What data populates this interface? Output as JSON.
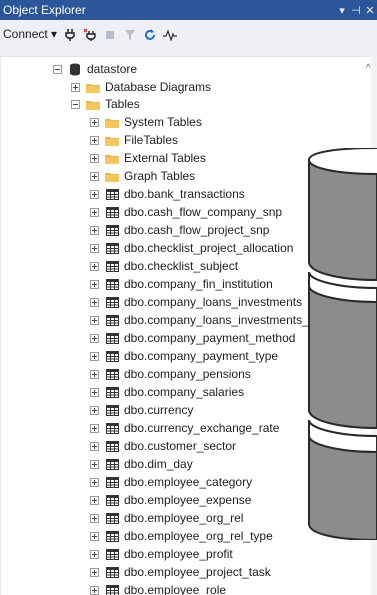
{
  "panel": {
    "title": "Object Explorer",
    "controls": [
      "▾",
      "⊣",
      "✕"
    ]
  },
  "toolbar": {
    "connect_label": "Connect ▾"
  },
  "tree": {
    "database": "datastore",
    "folders": [
      "Database Diagrams",
      "Tables"
    ],
    "table_subfolders": [
      "System Tables",
      "FileTables",
      "External Tables",
      "Graph Tables"
    ],
    "tables": [
      "dbo.bank_transactions",
      "dbo.cash_flow_company_snp",
      "dbo.cash_flow_project_snp",
      "dbo.checklist_project_allocation",
      "dbo.checklist_subject",
      "dbo.company_fin_institution",
      "dbo.company_loans_investments",
      "dbo.company_loans_investments_",
      "dbo.company_payment_method",
      "dbo.company_payment_type",
      "dbo.company_pensions",
      "dbo.company_salaries",
      "dbo.currency",
      "dbo.currency_exchange_rate",
      "dbo.customer_sector",
      "dbo.dim_day",
      "dbo.employee_category",
      "dbo.employee_expense",
      "dbo.employee_org_rel",
      "dbo.employee_org_rel_type",
      "dbo.employee_profit",
      "dbo.employee_project_task",
      "dbo.employee_role"
    ]
  },
  "colors": {
    "title_bar": "#2b579a",
    "folder": "#e8b64c",
    "cylinder": "#8c8c8c"
  }
}
